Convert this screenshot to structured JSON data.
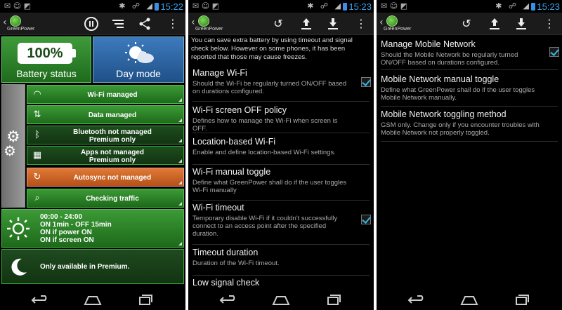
{
  "status": {
    "time1": "15:22",
    "time2": "15:23",
    "time3": "15:23"
  },
  "app": {
    "name": "GreenPower"
  },
  "screen1": {
    "battery_percent": "100%",
    "battery_label": "Battery status",
    "mode_label": "Day mode",
    "toggles": [
      {
        "label": "Wi-Fi managed",
        "icon": "wifi-icon"
      },
      {
        "label": "Data managed",
        "icon": "data-icon"
      },
      {
        "label": "Bluetooth not managed\nPremium only",
        "icon": "bluetooth-icon"
      },
      {
        "label": "Apps not managed\nPremium only",
        "icon": "apps-icon"
      },
      {
        "label": "Autosync not managed",
        "icon": "sync-icon"
      },
      {
        "label": "Checking traffic",
        "icon": "search-icon"
      }
    ],
    "schedule_day": [
      "00:00 - 24:00",
      "ON 1min - OFF 15min",
      "ON if power ON",
      "ON if screen ON"
    ],
    "schedule_night": "Only available in Premium."
  },
  "screen2": {
    "intro": "You can save extra battery by using timeout and signal check below. However on some phones, it has been reported that those may cause freezes.",
    "items": [
      {
        "title": "Manage Wi-Fi",
        "summary": "Should the Wi-Fi be regularly turned ON/OFF based on durations configured.",
        "checked": true
      },
      {
        "title": "Wi-Fi screen OFF policy",
        "summary": "Defines how to manage the Wi-Fi when screen is OFF."
      },
      {
        "title": "Location-based Wi-Fi",
        "summary": "Enable and define location-based Wi-Fi settings."
      },
      {
        "title": "Wi-Fi manual toggle",
        "summary": "Define what GreenPower shall do if the user toggles Wi-Fi manually"
      },
      {
        "title": "Wi-Fi timeout",
        "summary": "Temporary disable Wi-Fi if it couldn't successfully connect to an access point after the specified duration.",
        "checked": true
      },
      {
        "title": "Timeout duration",
        "summary": "Duration of the Wi-Fi timeout."
      },
      {
        "title": "Low signal check",
        "summary": ""
      }
    ]
  },
  "screen3": {
    "items": [
      {
        "title": "Manage Mobile Network",
        "summary": "Should the Mobile Network be regularly turned ON/OFF based on durations configured.",
        "checked": true
      },
      {
        "title": "Mobile Network manual toggle",
        "summary": "Define what GreenPower shall do if the user toggles Mobile Network manually."
      },
      {
        "title": "Mobile Network toggling method",
        "summary": "GSM only. Change only if you encounter troubles with Mobile Network not properly toggled."
      }
    ]
  },
  "colors": {
    "accent": "#33b5e5",
    "green": "#2e8a2a",
    "orange": "#d0682a",
    "blue": "#2e64a2"
  }
}
